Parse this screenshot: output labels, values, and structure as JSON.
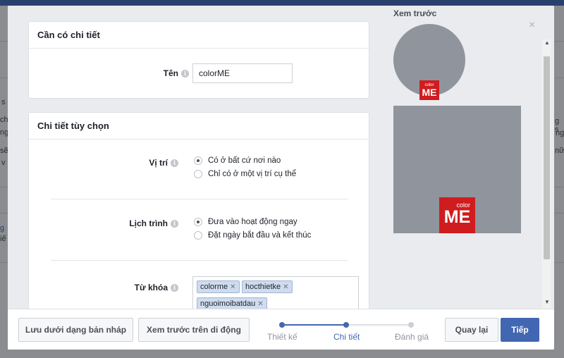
{
  "background": {
    "fragments": [
      "s",
      "ch",
      "ng",
      "sẽ",
      "v",
      "g",
      "iế",
      "g s",
      "ng",
      "nữ"
    ]
  },
  "dialog": {
    "close_symbol": "×",
    "required": {
      "title": "Cần có chi tiết",
      "name_label": "Tên",
      "name_value": "colorME"
    },
    "optional": {
      "title": "Chi tiết tùy chọn",
      "location": {
        "label": "Vị trí",
        "options": [
          "Có ở bất cứ nơi nào",
          "Chỉ có ở một vị trí cụ thể"
        ],
        "selected": 0
      },
      "schedule": {
        "label": "Lịch trình",
        "options": [
          "Đưa vào hoạt động ngay",
          "Đặt ngày bắt đầu và kết thúc"
        ],
        "selected": 0
      },
      "keywords": {
        "label": "Từ khóa",
        "tags": [
          "colorme",
          "hocthietke",
          "nguoimoibatdau"
        ]
      }
    },
    "preview": {
      "title": "Xem trước",
      "logo_small": "color",
      "logo_big": "ME"
    }
  },
  "footer": {
    "save_draft": "Lưu dưới dạng bản nháp",
    "mobile_preview": "Xem trước trên di động",
    "steps": [
      {
        "label": "Thiết kế",
        "state": "done"
      },
      {
        "label": "Chi tiết",
        "state": "active"
      },
      {
        "label": "Đánh giá",
        "state": "pending"
      }
    ],
    "back": "Quay lại",
    "next": "Tiếp"
  },
  "colors": {
    "accent": "#4267b2",
    "logo_red": "#cf1c1f",
    "preview_gray": "#90949c"
  },
  "icons": {
    "info": "info-icon",
    "close": "close-icon",
    "tag_remove": "remove-tag-icon"
  }
}
